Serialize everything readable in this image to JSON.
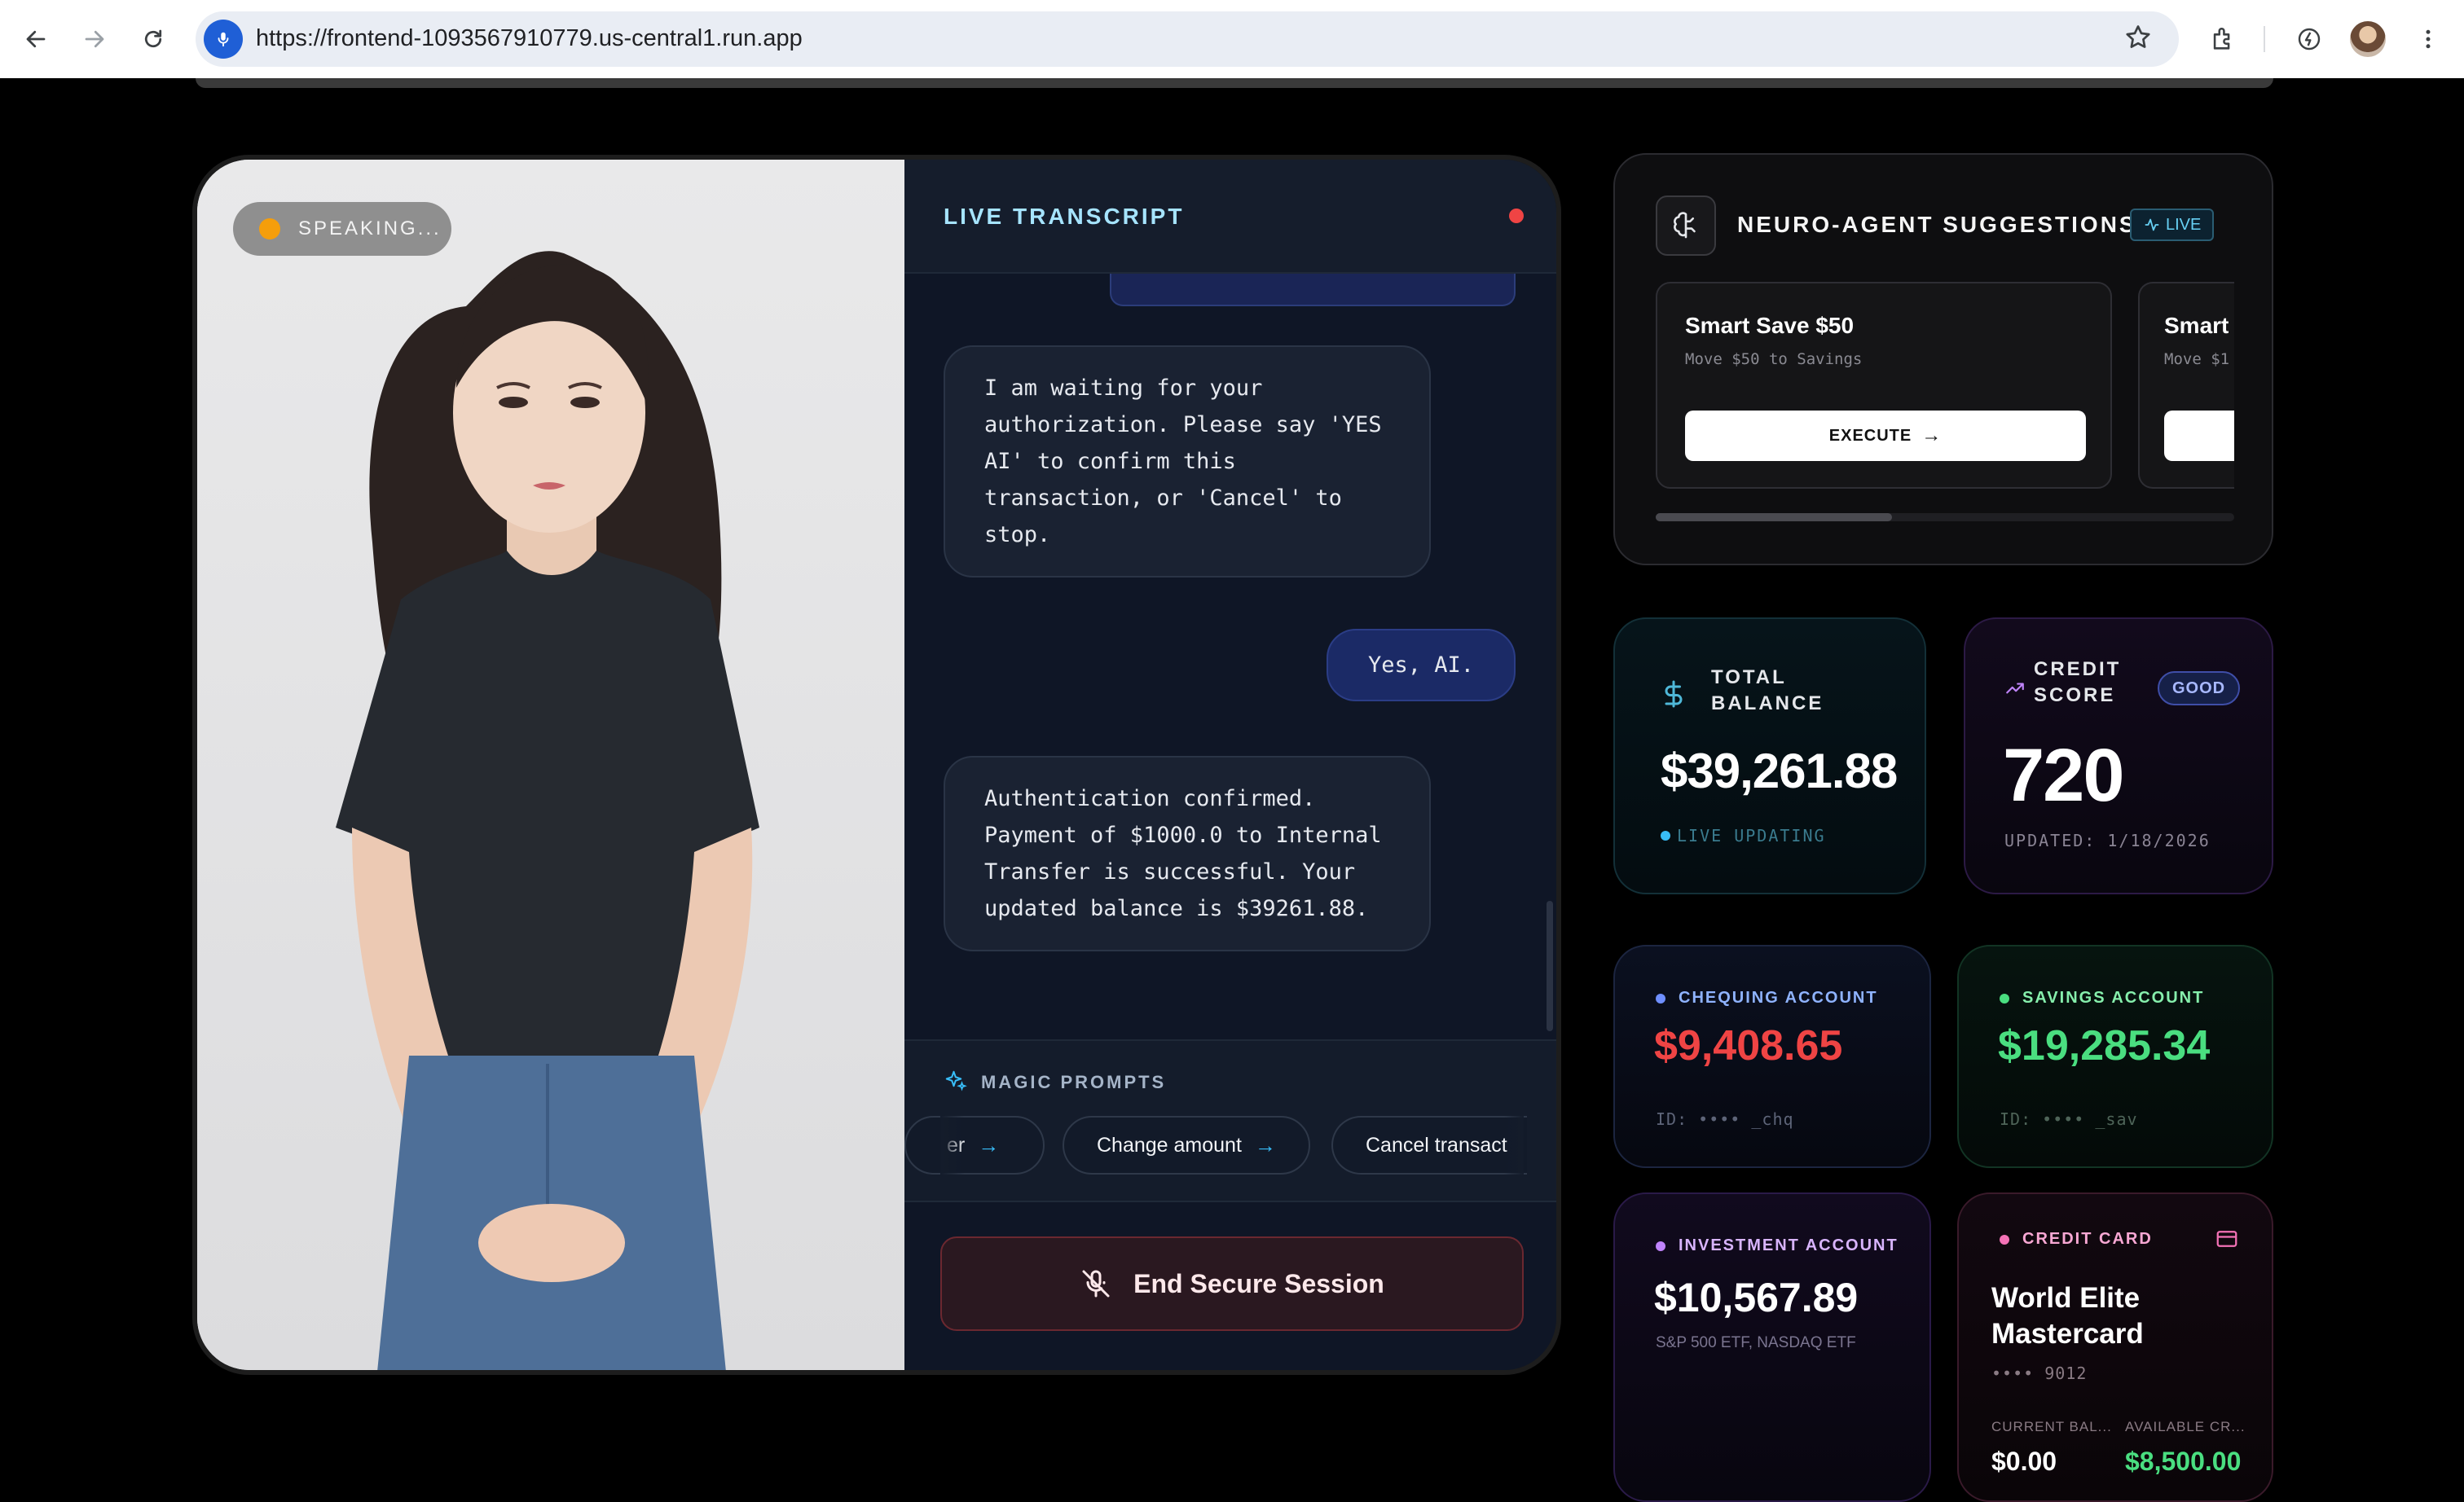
{
  "browser": {
    "url": "https://frontend-1093567910779.us-central1.run.app"
  },
  "video": {
    "status": "SPEAKING..."
  },
  "transcript": {
    "title": "LIVE TRANSCRIPT",
    "messages": [
      {
        "role": "ai",
        "text": "I am waiting for your authorization. Please say 'YES AI' to confirm this transaction, or 'Cancel' to stop."
      },
      {
        "role": "user",
        "text": "Yes, AI."
      },
      {
        "role": "ai",
        "text": "Authentication confirmed. Payment of $1000.0 to Internal Transfer is successful. Your updated balance is $39261.88."
      }
    ]
  },
  "magic_prompts": {
    "label": "MAGIC PROMPTS",
    "chips": [
      "er",
      "Change amount",
      "Cancel transact"
    ]
  },
  "end_session": {
    "label": "End Secure Session"
  },
  "neuro": {
    "title": "NEURO-AGENT SUGGESTIONS",
    "live": "LIVE",
    "suggestions": [
      {
        "title": "Smart Save $50",
        "sub": "Move $50 to Savings",
        "button": "EXECUTE"
      },
      {
        "title": "Smart",
        "sub": "Move $1",
        "button": ""
      }
    ]
  },
  "total_balance": {
    "label_line1": "TOTAL",
    "label_line2": "BALANCE",
    "value": "$39,261.88",
    "status": "LIVE UPDATING"
  },
  "credit_score": {
    "label_line1": "CREDIT",
    "label_line2": "SCORE",
    "badge": "GOOD",
    "value": "720",
    "updated": "UPDATED: 1/18/2026"
  },
  "accounts": {
    "chequing": {
      "label": "CHEQUING ACCOUNT",
      "value": "$9,408.65",
      "id": "ID: •••• _chq"
    },
    "savings": {
      "label": "SAVINGS ACCOUNT",
      "value": "$19,285.34",
      "id": "ID: •••• _sav"
    },
    "investment": {
      "label": "INVESTMENT ACCOUNT",
      "value": "$10,567.89",
      "sub": "S&P 500 ETF, NASDAQ ETF"
    },
    "credit_card": {
      "label": "CREDIT CARD",
      "name_line1": "World Elite",
      "name_line2": "Mastercard",
      "number": "•••• 9012",
      "current_label": "CURRENT BAL...",
      "current_value": "$0.00",
      "available_label": "AVAILABLE CR...",
      "available_value": "$8,500.00"
    }
  },
  "colors": {
    "accent_cyan": "#38bdf8",
    "chequing_red": "#ef4444",
    "savings_green": "#4ade80",
    "transcript_bg": "#0f1626"
  }
}
